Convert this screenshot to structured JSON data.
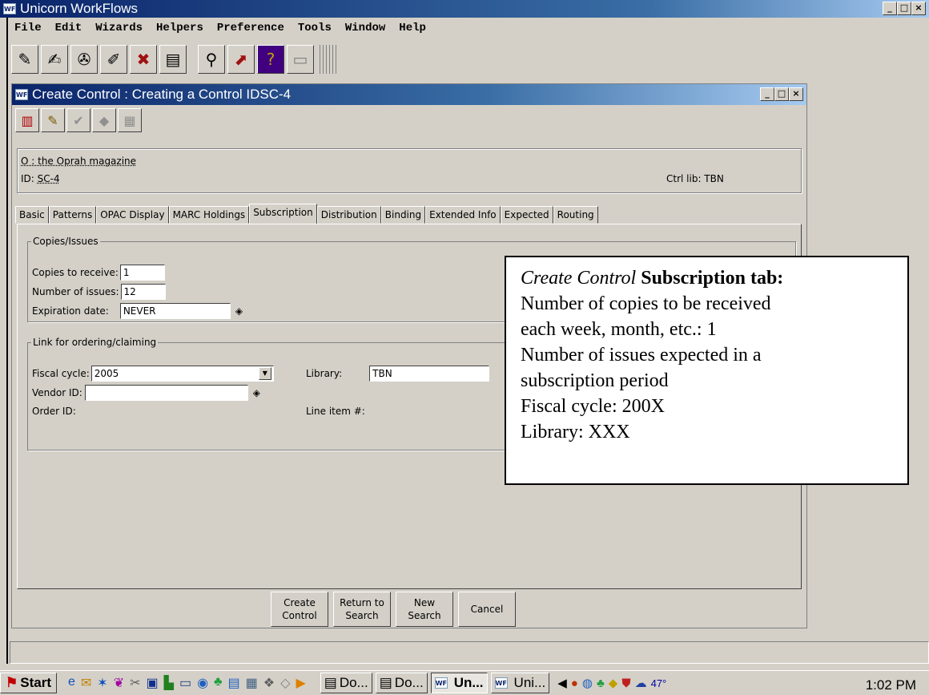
{
  "app": {
    "title": "Unicorn WorkFlows",
    "logo": "WF",
    "window_controls": [
      "_",
      "□",
      "×"
    ]
  },
  "menu": [
    "File",
    "Edit",
    "Wizards",
    "Helpers",
    "Preference",
    "Tools",
    "Window",
    "Help"
  ],
  "toolbar_icons": [
    "checkin-icon",
    "checkout-icon",
    "renew-icon",
    "reserve-icon",
    "bills-icon",
    "display-icon",
    "search-icon",
    "report-icon",
    "help-icon",
    "print-icon"
  ],
  "child_window": {
    "title": "Create Control : Creating a Control IDSC-4",
    "window_controls": [
      "_",
      "□",
      "×"
    ],
    "toolbar_icons": [
      "book-icon",
      "edit-icon",
      "check-icon",
      "item-icon",
      "copy-icon"
    ]
  },
  "record": {
    "title_line": "O : the Oprah magazine",
    "id_label": "ID:",
    "id_value": "SC-4",
    "ctrl_lib": "Ctrl lib: TBN"
  },
  "tabs": [
    {
      "label": "Basic",
      "active": false
    },
    {
      "label": "Patterns",
      "active": false
    },
    {
      "label": "OPAC Display",
      "active": false
    },
    {
      "label": "MARC Holdings",
      "active": false
    },
    {
      "label": "Subscription",
      "active": true
    },
    {
      "label": "Distribution",
      "active": false
    },
    {
      "label": "Binding",
      "active": false
    },
    {
      "label": "Extended Info",
      "active": false
    },
    {
      "label": "Expected",
      "active": false
    },
    {
      "label": "Routing",
      "active": false
    }
  ],
  "copies_issues": {
    "legend": "Copies/Issues",
    "copies_label": "Copies to receive:",
    "copies_value": "1",
    "issues_label": "Number of issues:",
    "issues_value": "12",
    "expiration_label": "Expiration date:",
    "expiration_value": "NEVER"
  },
  "link": {
    "legend": "Link for ordering/claiming",
    "fiscal_label": "Fiscal cycle:",
    "fiscal_value": "2005",
    "library_label": "Library:",
    "library_value": "TBN",
    "vendor_label": "Vendor ID:",
    "vendor_value": "",
    "order_label": "Order ID:",
    "line_item_label": "Line item #:"
  },
  "callout": {
    "heading_italic": "Create Control",
    "heading_bold": " Subscription tab:",
    "lines": [
      "Number of copies to be received",
      "each week, month, etc.: 1",
      "Number of issues expected in a",
      "subscription period",
      "Fiscal cycle: 200X",
      "Library: XXX"
    ]
  },
  "buttons": [
    {
      "line1": "Create",
      "line2": "Control"
    },
    {
      "line1": "Return to",
      "line2": "Search"
    },
    {
      "line1": "New",
      "line2": "Search"
    },
    {
      "line1": "Cancel",
      "line2": ""
    }
  ],
  "taskbar": {
    "start": "Start",
    "tasks": [
      {
        "label": "Do...",
        "active": false
      },
      {
        "label": "Do...",
        "active": false
      },
      {
        "label": "Un...",
        "active": true
      },
      {
        "label": "Uni...",
        "active": false
      }
    ],
    "temperature": "47°",
    "clock": "1:02 PM"
  }
}
